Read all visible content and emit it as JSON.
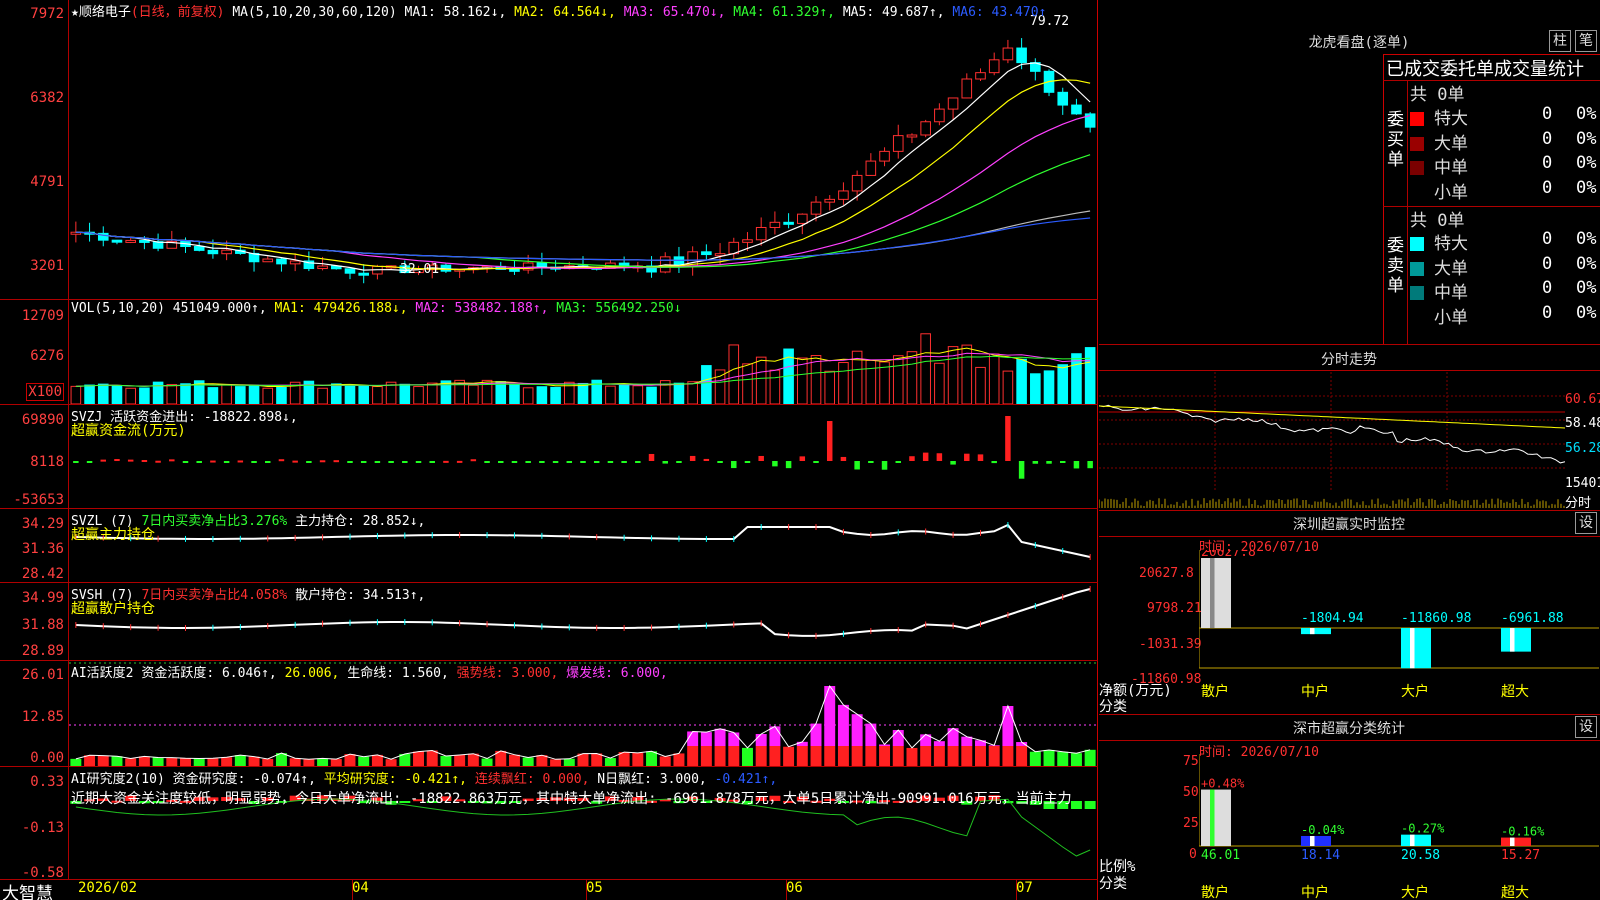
{
  "header": {
    "star": "★",
    "stock_name": "顺络电子",
    "mode": "(日线，前复权)",
    "ma_prefix": "MA(5,10,20,30,60,120)",
    "ma1": "MA1: 58.162↓,",
    "ma2": "MA2: 64.564↓,",
    "ma3": "MA3: 65.470↓,",
    "ma4": "MA4: 61.329↑,",
    "ma5": "MA5: 49.687↑,",
    "ma6": "MA6: 43.470↑"
  },
  "main_axis": [
    "7972",
    "6382",
    "4791",
    "3201"
  ],
  "main_labels": {
    "high": "79.72",
    "low": "32.01"
  },
  "vol": {
    "title": "VOL(5,10,20)",
    "value": "451049.000↑,",
    "ma1": "MA1: 479426.188↓,",
    "ma2": "MA2: 538482.188↑,",
    "ma3": "MA3: 556492.250↓",
    "axis": [
      "12709",
      "6276",
      "X100"
    ]
  },
  "svzj": {
    "title": "SVZJ",
    "line": "活跃资金进出: -18822.898↓,",
    "sub": "超赢资金流(万元)",
    "axis": [
      "69890",
      "8118",
      "-53653"
    ]
  },
  "svzl": {
    "title": "SVZL (7)",
    "text1": "7日内买卖净占比3.276%",
    "text2": "主力持仓: 28.852↓,",
    "sub": "超赢主力持仓",
    "axis": [
      "34.29",
      "31.36",
      "28.42"
    ]
  },
  "svsh": {
    "title": "SVSH (7)",
    "text1": "7日内买卖净占比4.058%",
    "text2": "散户持仓: 34.513↑,",
    "sub": "超赢散户持仓",
    "axis": [
      "34.99",
      "31.88",
      "28.89"
    ]
  },
  "aihy": {
    "title": "AI活跃度2",
    "t1": "资金活跃度: 6.046↑,",
    "t2": "26.006,",
    "t3": "生命线: 1.560,",
    "t4": "强势线: 3.000,",
    "t5": "爆发线: 6.000,",
    "axis": [
      "26.01",
      "12.85",
      "0.00"
    ]
  },
  "aiyj": {
    "title": "AI研究度2(10)",
    "t1": "资金研究度: -0.074↑,",
    "t2": "平均研究度: -0.421↑,",
    "t3": "连续飘红: 0.000,",
    "t4": "N日飘红: 3.000,",
    "t5": "-0.421↑,",
    "comment": "近期大资金关注度较低，明显弱势，今日大单净流出: -18822.863万元，其中特大单净流出: -6961.878万元，大单5日累计净出-90991.016万元，当前主力",
    "axis": [
      "0.33",
      "-0.13",
      "-0.58"
    ]
  },
  "xaxis": {
    "brand": "大智慧",
    "labels": [
      "2026/02",
      "04",
      "05",
      "06",
      "07"
    ]
  },
  "longhu": {
    "title": "龙虎看盘(逐单)",
    "btn1": "柱",
    "btn2": "笔",
    "header": "已成交委托单成交量统计",
    "buy_label": "委买单",
    "sell_label": "委卖单",
    "buy_total": "共 0单",
    "sell_total": "共 0单",
    "buy_rows": [
      {
        "name": "特大",
        "count": "0",
        "pct": "0%",
        "color": "#ff0000"
      },
      {
        "name": "大单",
        "count": "0",
        "pct": "0%",
        "color": "#9a0000"
      },
      {
        "name": "中单",
        "count": "0",
        "pct": "0%",
        "color": "#7a0000"
      },
      {
        "name": "小单",
        "count": "0",
        "pct": "0%",
        "color": "#000000"
      }
    ],
    "sell_rows": [
      {
        "name": "特大",
        "count": "0",
        "pct": "0%",
        "color": "#00ffff"
      },
      {
        "name": "大单",
        "count": "0",
        "pct": "0%",
        "color": "#009a9a"
      },
      {
        "name": "中单",
        "count": "0",
        "pct": "0%",
        "color": "#007a7a"
      },
      {
        "name": "小单",
        "count": "0",
        "pct": "0%",
        "color": "#000000"
      }
    ]
  },
  "intraday": {
    "title": "分时走势",
    "axis": [
      "60.67",
      "58.48",
      "56.28",
      "15401"
    ],
    "label": "分时"
  },
  "monitor": {
    "title": "深圳超赢实时监控",
    "btn": "设",
    "time": "时间: 2026/07/10",
    "axis": [
      "20627.8",
      "9798.21",
      "-1031.39",
      "-11860.98"
    ],
    "ylabel1": "净额(万元)",
    "ylabel2": "分类",
    "bars": [
      {
        "cat": "散户",
        "value": "20627.8"
      },
      {
        "cat": "中户",
        "value": "-1804.94"
      },
      {
        "cat": "大户",
        "value": "-11860.98"
      },
      {
        "cat": "超大",
        "value": "-6961.88"
      }
    ]
  },
  "classify": {
    "title": "深市超赢分类统计",
    "btn": "设",
    "time": "时间: 2026/07/10",
    "axis": [
      "75",
      "50",
      "25",
      "0"
    ],
    "ylabel1": "比例%",
    "ylabel2": "分类",
    "bars": [
      {
        "cat": "散户",
        "top": "+0.48%",
        "value": "46.01"
      },
      {
        "cat": "中户",
        "top": "-0.04%",
        "value": "18.14"
      },
      {
        "cat": "大户",
        "top": "-0.27%",
        "value": "20.58"
      },
      {
        "cat": "超大",
        "top": "-0.16%",
        "value": "15.27"
      }
    ]
  }
}
